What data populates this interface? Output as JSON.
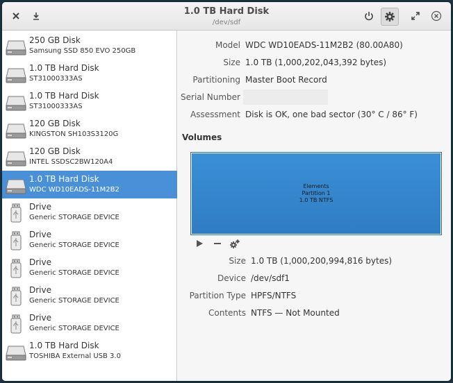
{
  "window": {
    "title": "1.0 TB Hard Disk",
    "subtitle": "/dev/sdf"
  },
  "colors": {
    "accent": "#4a90d9",
    "partition": "#3583cc",
    "titlebar": "#eeeeee"
  },
  "sidebar": {
    "items": [
      {
        "name": "250 GB Disk",
        "model": "Samsung SSD 850 EVO 250GB",
        "icon": "hard-disk-icon",
        "selected": false
      },
      {
        "name": "1.0 TB Hard Disk",
        "model": "ST31000333AS",
        "icon": "hard-disk-icon",
        "selected": false
      },
      {
        "name": "1.0 TB Hard Disk",
        "model": "ST31000333AS",
        "icon": "hard-disk-icon",
        "selected": false
      },
      {
        "name": "120 GB Disk",
        "model": "KINGSTON SH103S3120G",
        "icon": "hard-disk-icon",
        "selected": false
      },
      {
        "name": "120 GB Disk",
        "model": "INTEL SSDSC2BW120A4",
        "icon": "hard-disk-icon",
        "selected": false
      },
      {
        "name": "1.0 TB Hard Disk",
        "model": "WDC WD10EADS-11M2B2",
        "icon": "hard-disk-icon",
        "selected": true
      },
      {
        "name": "Drive",
        "model": "Generic STORAGE DEVICE",
        "icon": "usb-drive-icon",
        "selected": false
      },
      {
        "name": "Drive",
        "model": "Generic STORAGE DEVICE",
        "icon": "usb-drive-icon",
        "selected": false
      },
      {
        "name": "Drive",
        "model": "Generic STORAGE DEVICE",
        "icon": "usb-drive-icon",
        "selected": false
      },
      {
        "name": "Drive",
        "model": "Generic STORAGE DEVICE",
        "icon": "usb-drive-icon",
        "selected": false
      },
      {
        "name": "Drive",
        "model": "Generic STORAGE DEVICE",
        "icon": "usb-drive-icon",
        "selected": false
      },
      {
        "name": "1.0 TB Hard Disk",
        "model": "TOSHIBA External USB 3.0",
        "icon": "hard-disk-icon",
        "selected": false
      }
    ]
  },
  "disk": {
    "model_label": "Model",
    "model": "WDC WD10EADS-11M2B2 (80.00A80)",
    "size_label": "Size",
    "size": "1.0 TB (1,000,202,043,392 bytes)",
    "partitioning_label": "Partitioning",
    "partitioning": "Master Boot Record",
    "serial_label": "Serial Number",
    "serial": "",
    "assessment_label": "Assessment",
    "assessment": "Disk is OK, one bad sector (30° C / 86° F)"
  },
  "volumes": {
    "title": "Volumes",
    "partition": {
      "line1": "Elements",
      "line2": "Partition 1",
      "line3": "1.0 TB NTFS"
    },
    "size_label": "Size",
    "size": "1.0 TB (1,000,200,994,816 bytes)",
    "device_label": "Device",
    "device": "/dev/sdf1",
    "type_label": "Partition Type",
    "type": "HPFS/NTFS",
    "contents_label": "Contents",
    "contents": "NTFS — Not Mounted"
  }
}
